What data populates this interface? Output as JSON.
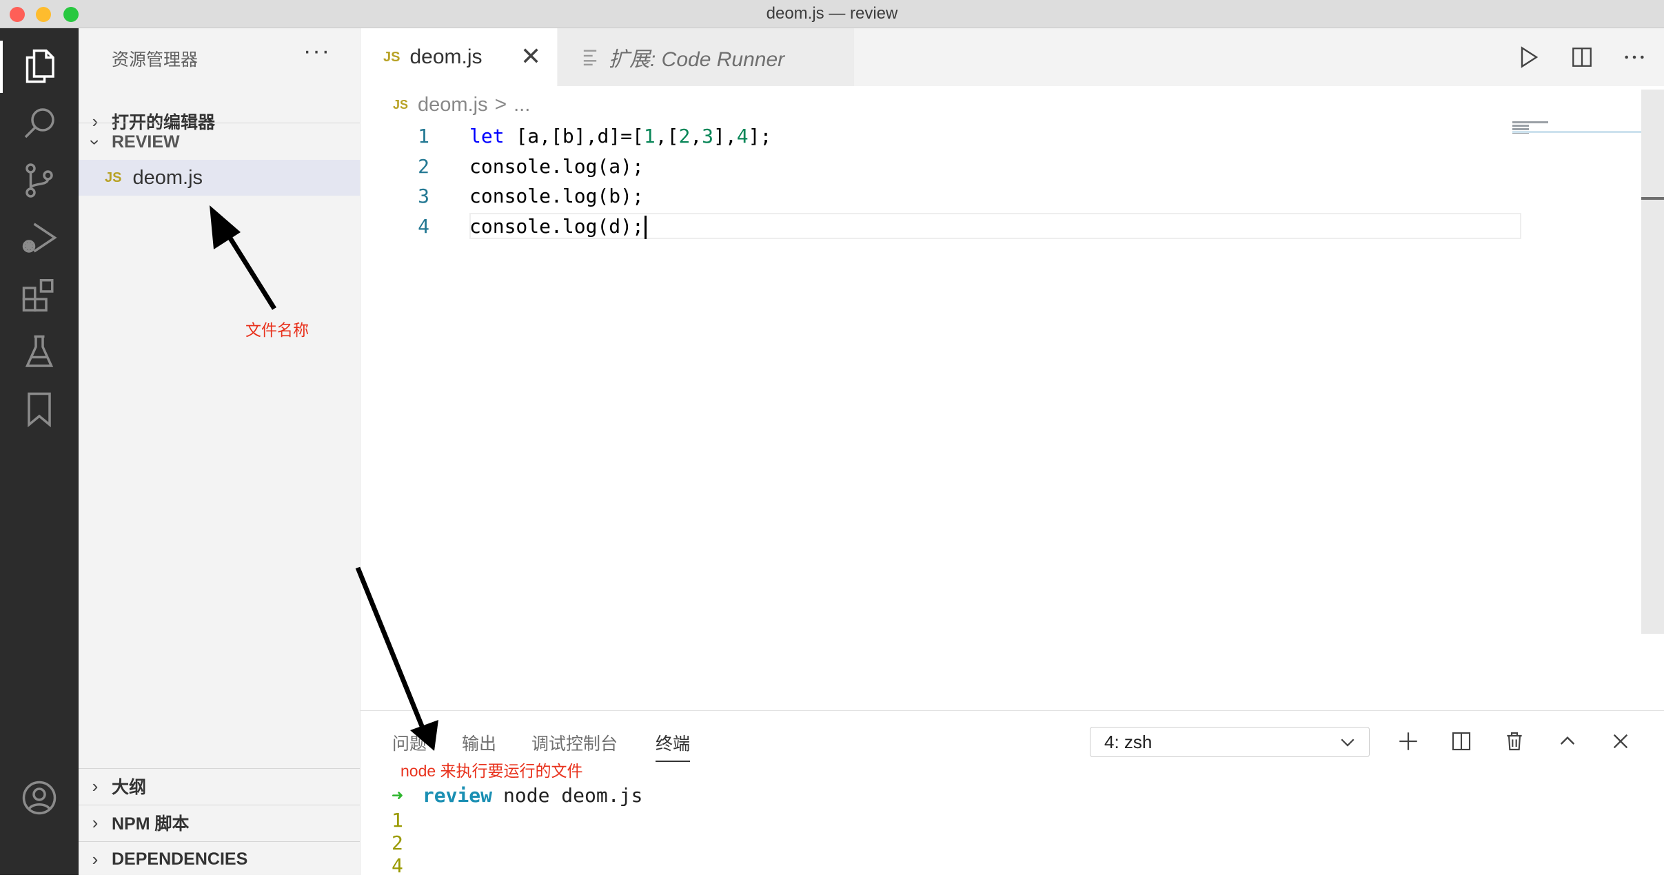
{
  "window": {
    "title": "deom.js — review"
  },
  "activity_bar": {
    "items": [
      "explorer-icon",
      "search-icon",
      "source-control-icon",
      "run-debug-icon",
      "extensions-icon",
      "testing-icon",
      "bookmark-icon",
      "account-icon"
    ]
  },
  "sidebar": {
    "header": "资源管理器",
    "more": "···",
    "open_editors": "打开的编辑器",
    "folder": "REVIEW",
    "file_badge": "JS",
    "file_name": "deom.js",
    "outline": "大纲",
    "npm_scripts": "NPM 脚本",
    "dependencies": "DEPENDENCIES"
  },
  "tabs": [
    {
      "badge": "JS",
      "label": "deom.js",
      "active": true
    },
    {
      "label": "扩展: Code Runner",
      "active": false
    }
  ],
  "breadcrumb": {
    "badge": "JS",
    "file": "deom.js",
    "separator": ">",
    "more": "..."
  },
  "code": {
    "line_numbers": [
      "1",
      "2",
      "3",
      "4"
    ],
    "line1": {
      "kw": "let",
      "p1": " [a,[b],d]=[",
      "n1": "1",
      "p2": ",[",
      "n2": "2",
      "p3": ",",
      "n3": "3",
      "p4": "],",
      "n4": "4",
      "p5": "];"
    },
    "line2": "console.log(a);",
    "line3": "console.log(b);",
    "line4": "console.log(d);"
  },
  "panel": {
    "tabs": [
      "问题",
      "输出",
      "调试控制台",
      "终端"
    ],
    "active_tab": "终端",
    "terminal_select": "4: zsh",
    "terminal": {
      "arrow": "➜",
      "dir": "review",
      "command": "node deom.js",
      "output": [
        "1",
        "2",
        "4"
      ]
    }
  },
  "annotations": {
    "file_name_note": "文件名称",
    "node_note": "node 来执行要运行的文件"
  },
  "colors": {
    "activity_bar": "#2c2c2c",
    "sidebar": "#f3f3f3",
    "keyword": "#0000ff",
    "number": "#098658",
    "js_badge": "#b8a226",
    "annotation": "#e8321d",
    "terminal_prompt": "#2db52d",
    "terminal_dir": "#1a8fb3"
  }
}
